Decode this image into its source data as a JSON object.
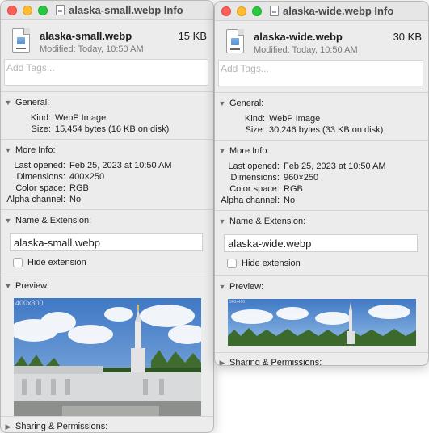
{
  "windows": [
    {
      "title": "alaska-small.webp Info",
      "file_name": "alaska-small.webp",
      "size_short": "15 KB",
      "modified": "Modified: Today, 10:50 AM",
      "tags_placeholder": "Add Tags...",
      "general": {
        "label": "General:",
        "kind_label": "Kind:",
        "kind": "WebP Image",
        "size_label": "Size:",
        "size": "15,454 bytes (16 KB on disk)"
      },
      "more_info": {
        "label": "More Info:",
        "last_opened_label": "Last opened:",
        "last_opened": "Feb 25, 2023 at 10:50 AM",
        "dimensions_label": "Dimensions:",
        "dimensions": "400×250",
        "color_space_label": "Color space:",
        "color_space": "RGB",
        "alpha_label": "Alpha channel:",
        "alpha": "No"
      },
      "name_ext": {
        "label": "Name & Extension:",
        "value": "alaska-small.webp",
        "hide_label": "Hide extension"
      },
      "preview": {
        "label": "Preview:",
        "overlay": "400x300"
      },
      "sharing_label": "Sharing & Permissions:"
    },
    {
      "title": "alaska-wide.webp Info",
      "file_name": "alaska-wide.webp",
      "size_short": "30 KB",
      "modified": "Modified: Today, 10:50 AM",
      "tags_placeholder": "Add Tags...",
      "general": {
        "label": "General:",
        "kind_label": "Kind:",
        "kind": "WebP Image",
        "size_label": "Size:",
        "size": "30,246 bytes (33 KB on disk)"
      },
      "more_info": {
        "label": "More Info:",
        "last_opened_label": "Last opened:",
        "last_opened": "Feb 25, 2023 at 10:50 AM",
        "dimensions_label": "Dimensions:",
        "dimensions": "960×250",
        "color_space_label": "Color space:",
        "color_space": "RGB",
        "alpha_label": "Alpha channel:",
        "alpha": "No"
      },
      "name_ext": {
        "label": "Name & Extension:",
        "value": "alaska-wide.webp",
        "hide_label": "Hide extension"
      },
      "preview": {
        "label": "Preview:",
        "overlay": "960x400"
      },
      "sharing_label": "Sharing & Permissions:"
    }
  ],
  "colors": {
    "close": "#fe5f57",
    "minimize": "#febc2e",
    "zoom": "#28c840",
    "window_bg": "#ececec"
  },
  "icons": {
    "section_expanded": "chevron-down-icon",
    "section_collapsed": "chevron-right-icon",
    "file": "webp-document-icon"
  }
}
